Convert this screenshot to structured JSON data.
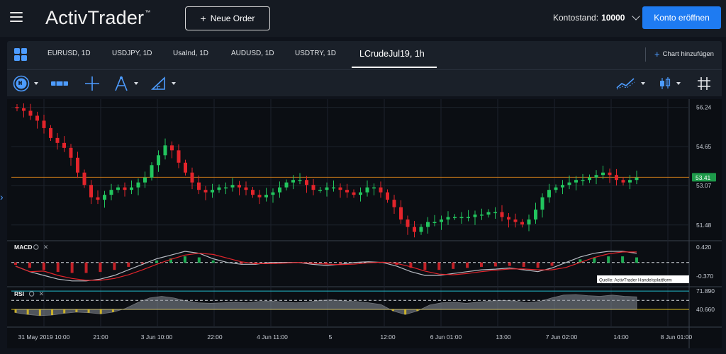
{
  "header": {
    "logo_text": "ActivTrader",
    "logo_tm": "™",
    "new_order_label": "Neue Order",
    "balance_label": "Kontostand:",
    "balance_value": "10000",
    "open_account_label": "Konto eröffnen"
  },
  "tabs": [
    {
      "label": "EURUSD, 1D"
    },
    {
      "label": "USDJPY, 1D"
    },
    {
      "label": "UsaInd, 1D"
    },
    {
      "label": "AUDUSD, 1D"
    },
    {
      "label": "USDTRY, 1D"
    },
    {
      "label": "LCrudeJul19, 1h"
    }
  ],
  "add_chart_label": "Chart hinzufügen",
  "toolbar": {
    "icons": [
      "timeframe-icon",
      "chart-style-icon",
      "crosshair-icon",
      "drawing-tools-icon",
      "measure-icon",
      "indicators-icon",
      "candle-type-icon",
      "grid-icon"
    ]
  },
  "colors": {
    "accent": "#1e7bf2",
    "bull": "#22c55e",
    "bear": "#e3242b",
    "price_line": "#c8781a",
    "rsi_line": "#22b8c8",
    "rsi_low": "#e0c222"
  },
  "panels": {
    "macd_label": "MACD",
    "rsi_label": "RSI",
    "source_note": "Quelle: ActivTrader Handelsplattform"
  },
  "chart_data": {
    "type": "candlestick",
    "symbol": "LCrudeJul19, 1h",
    "price_axis_ticks": [
      "56.24",
      "54.65",
      "53.07",
      "51.48"
    ],
    "last_price": "53.41",
    "macd_axis_ticks": [
      "0.420",
      "-0.370"
    ],
    "rsi_axis_ticks": [
      "71.890",
      "40.660"
    ],
    "x_tick_labels": [
      "31 May 2019 10:00",
      "21:00",
      "3 Jun 10:00",
      "22:00",
      "4 Jun 11:00",
      "5",
      "12:00",
      "6 Jun 01:00",
      "13:00",
      "7 Jun 02:00",
      "14:00",
      "8 Jun 01:00"
    ],
    "close_series": [
      56.2,
      56.1,
      55.9,
      55.7,
      55.4,
      55.0,
      54.8,
      54.6,
      54.2,
      53.6,
      53.1,
      52.6,
      52.5,
      52.7,
      52.9,
      53.0,
      52.9,
      53.0,
      53.2,
      53.4,
      53.9,
      54.3,
      54.7,
      54.5,
      54.0,
      53.6,
      53.2,
      52.9,
      52.8,
      52.9,
      53.0,
      53.0,
      53.1,
      53.0,
      52.9,
      52.7,
      52.6,
      52.7,
      52.8,
      53.0,
      53.2,
      53.3,
      53.3,
      53.1,
      52.9,
      52.9,
      53.0,
      53.0,
      52.9,
      52.8,
      52.7,
      52.8,
      53.0,
      53.0,
      52.8,
      52.5,
      52.2,
      51.7,
      51.4,
      51.2,
      51.4,
      51.6,
      51.6,
      51.7,
      51.8,
      51.8,
      51.8,
      51.8,
      51.9,
      51.9,
      52.0,
      52.0,
      51.8,
      51.7,
      51.6,
      51.5,
      51.7,
      52.1,
      52.6,
      52.9,
      53.0,
      53.1,
      53.2,
      53.3,
      53.3,
      53.4,
      53.5,
      53.6,
      53.5,
      53.3,
      53.2,
      53.3,
      53.4
    ],
    "macd_series": [
      -0.1,
      -0.25,
      -0.35,
      -0.45,
      -0.5,
      -0.5,
      -0.45,
      -0.35,
      -0.2,
      -0.05,
      0.1,
      0.2,
      0.3,
      0.25,
      0.1,
      0.0,
      -0.05,
      -0.05,
      0.0,
      0.0,
      0.0,
      -0.05,
      -0.08,
      -0.05,
      0.0,
      0.02,
      0.0,
      -0.1,
      -0.25,
      -0.35,
      -0.35,
      -0.3,
      -0.25,
      -0.2,
      -0.18,
      -0.15,
      -0.2,
      -0.25,
      -0.15,
      0.0,
      0.15,
      0.25,
      0.3,
      0.3,
      0.25
    ],
    "rsi_series": [
      35,
      32,
      30,
      31,
      34,
      36,
      35,
      33,
      36,
      42,
      52,
      60,
      63,
      60,
      55,
      52,
      51,
      52,
      53,
      52,
      54,
      55,
      53,
      52,
      53,
      56,
      57,
      55,
      54,
      52,
      49,
      38,
      32,
      38,
      48,
      52,
      53,
      51,
      53,
      55,
      56,
      55,
      52,
      54,
      60,
      65,
      66,
      64,
      63,
      65,
      63,
      62
    ]
  }
}
